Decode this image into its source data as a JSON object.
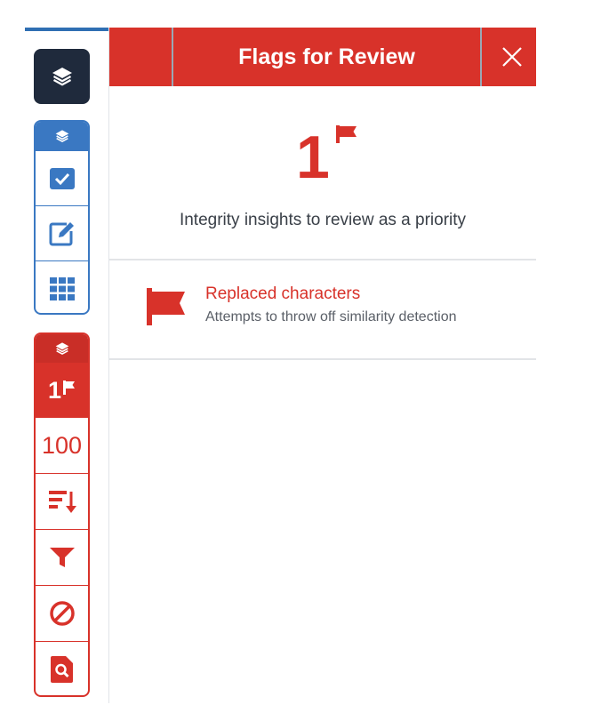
{
  "panel": {
    "title": "Flags for Review",
    "close_icon": "close-icon"
  },
  "summary": {
    "count": "1",
    "description": "Integrity insights to review as a priority"
  },
  "flags": [
    {
      "title": "Replaced characters",
      "description": "Attempts to throw off similarity detection",
      "icon": "flag-icon"
    }
  ],
  "rail": {
    "top_button_icon": "layers-icon",
    "blue_group": {
      "header_icon": "layers-icon",
      "items": [
        "checkbox-icon",
        "edit-icon",
        "grid-icon"
      ]
    },
    "red_group": {
      "header_icon": "layers-icon",
      "flag_count": "1",
      "match_percent": "100",
      "items": [
        "sort-icon",
        "filter-icon",
        "exclude-icon",
        "search-document-icon"
      ]
    }
  },
  "colors": {
    "brand_red": "#d8322a",
    "blue": "#3a78c2",
    "dark": "#1f2a3c"
  }
}
